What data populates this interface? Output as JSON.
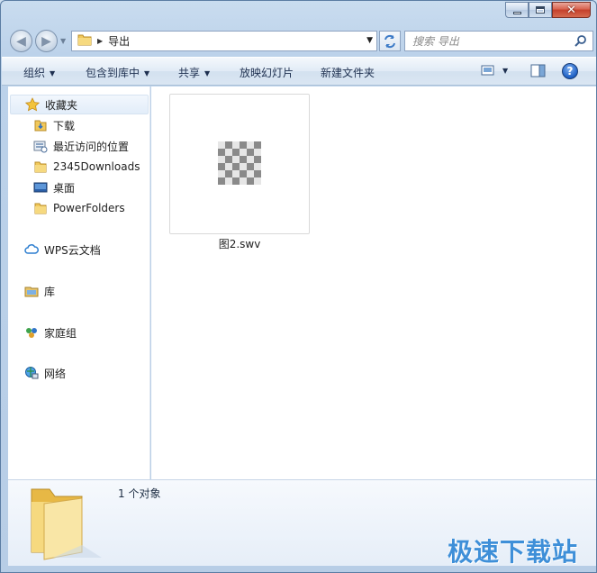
{
  "address": {
    "crumb": "导出"
  },
  "search": {
    "placeholder": "搜索 导出"
  },
  "toolbar": {
    "organize": "组织",
    "include_in_library": "包含到库中",
    "share": "共享",
    "slideshow": "放映幻灯片",
    "new_folder": "新建文件夹"
  },
  "help": {
    "label": "?"
  },
  "nav": {
    "favorites": "收藏夹",
    "fav_items": [
      "下载",
      "最近访问的位置",
      "2345Downloads",
      "桌面",
      "PowerFolders"
    ],
    "wps": "WPS云文档",
    "libraries": "库",
    "homegroup": "家庭组",
    "network": "网络"
  },
  "files": [
    {
      "name": "图2.swv",
      "icon": "checkerboard-thumbnail"
    }
  ],
  "details": {
    "count": "1 个对象"
  },
  "watermark": "极速下载站",
  "colors": {
    "accent": "#3e8fd8",
    "window_frame": "#bcd2ea",
    "folder": "#f1c85a"
  }
}
